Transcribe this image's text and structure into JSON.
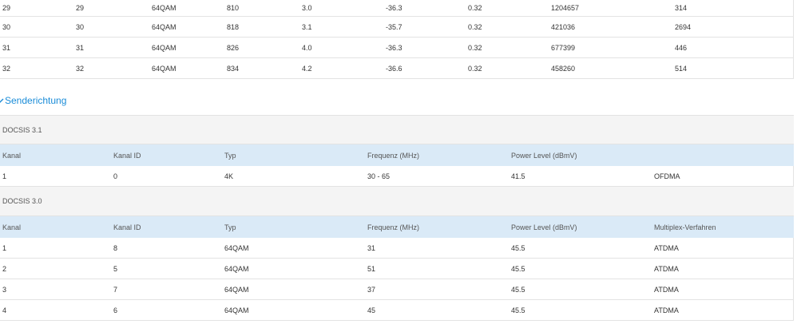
{
  "downstream": {
    "rows": [
      [
        "29",
        "29",
        "64QAM",
        "810",
        "3.0",
        "-36.3",
        "0.32",
        "1204657",
        "314"
      ],
      [
        "30",
        "30",
        "64QAM",
        "818",
        "3.1",
        "-35.7",
        "0.32",
        "421036",
        "2694"
      ],
      [
        "31",
        "31",
        "64QAM",
        "826",
        "4.0",
        "-36.3",
        "0.32",
        "677399",
        "446"
      ],
      [
        "32",
        "32",
        "64QAM",
        "834",
        "4.2",
        "-36.6",
        "0.32",
        "458260",
        "514"
      ]
    ]
  },
  "upstream": {
    "title": "Senderichtung",
    "chevron": "chevron-down-icon",
    "docsis31": {
      "label": "DOCSIS 3.1",
      "headers": [
        "Kanal",
        "Kanal ID",
        "Typ",
        "Frequenz (MHz)",
        "Power Level (dBmV)",
        ""
      ],
      "rows": [
        [
          "1",
          "0",
          "4K",
          "30 - 65",
          "41.5",
          "OFDMA"
        ]
      ]
    },
    "docsis30": {
      "label": "DOCSIS 3.0",
      "headers": [
        "Kanal",
        "Kanal ID",
        "Typ",
        "Frequenz (MHz)",
        "Power Level (dBmV)",
        "Multiplex-Verfahren"
      ],
      "rows": [
        [
          "1",
          "8",
          "64QAM",
          "31",
          "45.5",
          "ATDMA"
        ],
        [
          "2",
          "5",
          "64QAM",
          "51",
          "45.5",
          "ATDMA"
        ],
        [
          "3",
          "7",
          "64QAM",
          "37",
          "45.5",
          "ATDMA"
        ],
        [
          "4",
          "6",
          "64QAM",
          "45",
          "45.5",
          "ATDMA"
        ]
      ]
    }
  },
  "colors": {
    "link": "#1a8cd8",
    "header_bg": "#daeaf7",
    "group_bg": "#f4f4f4",
    "border": "#e3e3e3"
  }
}
